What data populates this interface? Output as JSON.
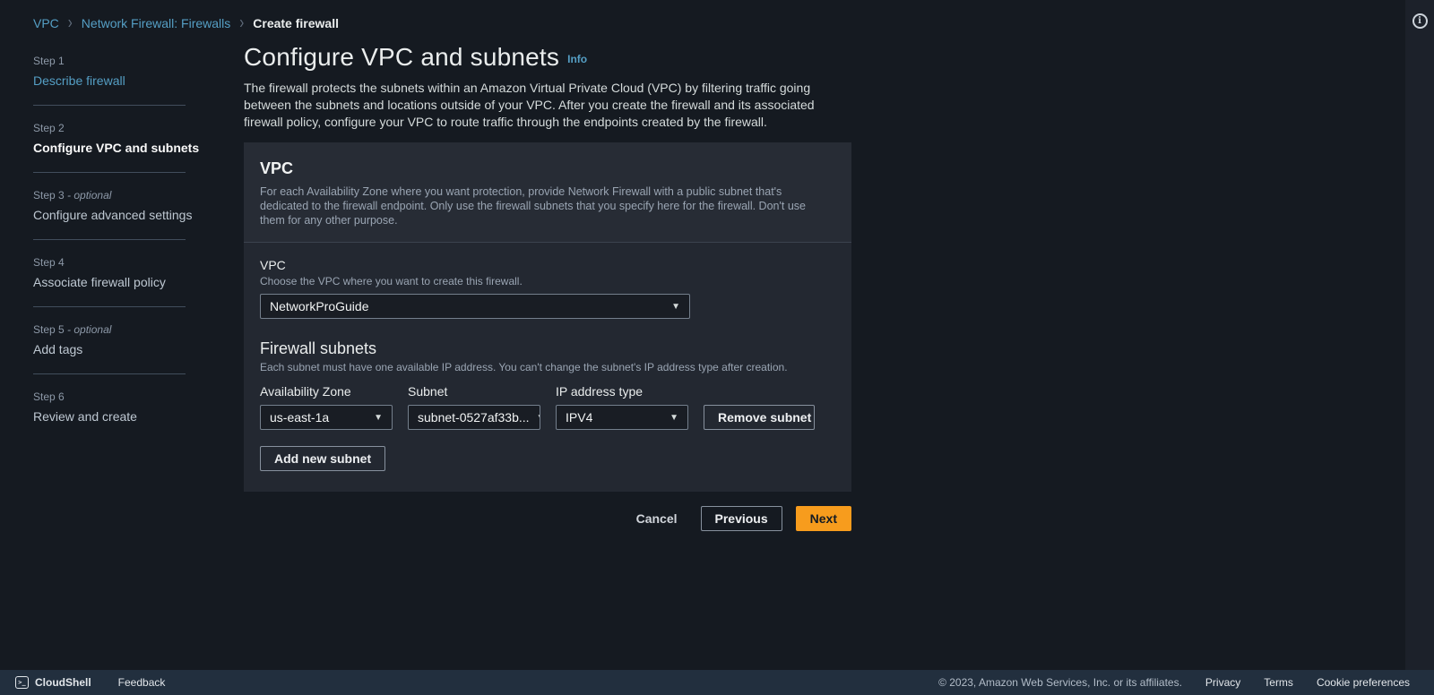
{
  "colors": {
    "link_accent": "#559fc5",
    "primary_button": "#f79c1d",
    "page_background": "#151a21",
    "panel_header_background": "#272c35",
    "panel_body_background": "#232831",
    "footer_background": "#222f3e"
  },
  "breadcrumb": {
    "vpc": "VPC",
    "section": "Network Firewall: Firewalls",
    "current": "Create firewall",
    "separator": "›"
  },
  "steps": [
    {
      "label": "Step 1",
      "suffix": "",
      "title": "Describe firewall"
    },
    {
      "label": "Step 2",
      "suffix": "",
      "title": "Configure VPC and subnets"
    },
    {
      "label": "Step 3",
      "suffix": "- optional",
      "title": "Configure advanced settings"
    },
    {
      "label": "Step 4",
      "suffix": "",
      "title": "Associate firewall policy"
    },
    {
      "label": "Step 5",
      "suffix": "- optional",
      "title": "Add tags"
    },
    {
      "label": "Step 6",
      "suffix": "",
      "title": "Review and create"
    }
  ],
  "page": {
    "title": "Configure VPC and subnets",
    "info_label": "Info",
    "description": "The firewall protects the subnets within an Amazon Virtual Private Cloud (VPC) by filtering traffic going between the subnets and locations outside of your VPC. After you create the firewall and its associated firewall policy, configure your VPC to route traffic through the endpoints created by the firewall."
  },
  "vpc_panel": {
    "heading": "VPC",
    "description": "For each Availability Zone where you want protection, provide Network Firewall with a public subnet that's dedicated to the firewall endpoint. Only use the firewall subnets that you specify here for the firewall. Don't use them for any other purpose.",
    "vpc_field": {
      "label": "VPC",
      "description": "Choose the VPC where you want to create this firewall.",
      "value": "NetworkProGuide"
    },
    "firewall_subnets": {
      "heading": "Firewall subnets",
      "description": "Each subnet must have one available IP address. You can't change the subnet's IP address type after creation.",
      "columns": [
        "Availability Zone",
        "Subnet",
        "IP address type"
      ],
      "rows": [
        {
          "availability_zone": "us-east-1a",
          "subnet": "subnet-0527af33b...",
          "ip_address_type": "IPV4"
        }
      ],
      "remove_button": "Remove subnet",
      "add_button": "Add new subnet"
    }
  },
  "actions": {
    "cancel": "Cancel",
    "previous": "Previous",
    "next": "Next"
  },
  "footer": {
    "cloudshell": "CloudShell",
    "feedback": "Feedback",
    "copyright": "© 2023, Amazon Web Services, Inc. or its affiliates.",
    "privacy": "Privacy",
    "terms": "Terms",
    "cookie_preferences": "Cookie preferences"
  },
  "icons": {
    "breadcrumb_separator": "›",
    "dropdown_glyph": "▼",
    "info_glyph": "i",
    "cloudshell_glyph": ">_"
  }
}
